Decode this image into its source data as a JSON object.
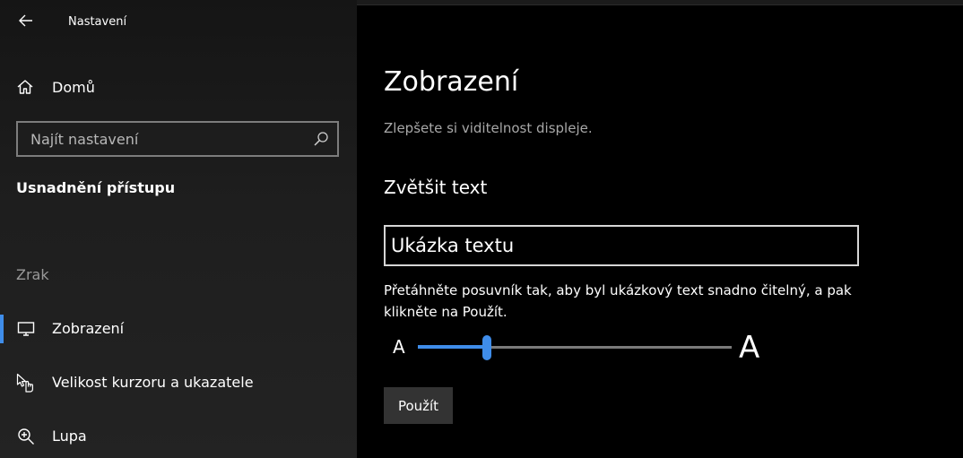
{
  "window": {
    "title": "Nastavení"
  },
  "sidebar": {
    "home_label": "Domů",
    "search_placeholder": "Najít nastavení",
    "section_title": "Usnadnění přístupu",
    "group_label": "Zrak",
    "items": [
      {
        "label": "Zobrazení",
        "icon": "monitor-icon",
        "active": true
      },
      {
        "label": "Velikost kurzoru a ukazatele",
        "icon": "cursor-pointer-icon",
        "active": false
      },
      {
        "label": "Lupa",
        "icon": "magnifier-plus-icon",
        "active": false
      }
    ]
  },
  "main": {
    "title": "Zobrazení",
    "subtitle": "Zlepšete si viditelnost displeje.",
    "section_heading": "Zvětšit text",
    "sample_text": "Ukázka textu",
    "description": "Přetáhněte posuvník tak, aby byl ukázkový text snadno čitelný, a pak klikněte na Použít.",
    "slider": {
      "min_label": "A",
      "max_label": "A",
      "value_fraction": 0.22
    },
    "apply_label": "Použít"
  },
  "colors": {
    "accent": "#3f8dea",
    "background": "#000000",
    "sidebar": "#1e1e1e",
    "muted_text": "#a8a8a8"
  }
}
